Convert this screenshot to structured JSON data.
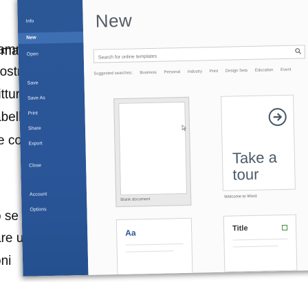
{
  "background_text": {
    "lines": [
      "ramma",
      "nostra",
      "rittura",
      "abelle,",
      "e  con",
      "o se",
      "are un",
      "oni"
    ]
  },
  "sidebar": {
    "items": [
      {
        "label": "Info",
        "active": false
      },
      {
        "label": "New",
        "active": true
      },
      {
        "label": "Open",
        "active": false
      },
      {
        "label": "Save",
        "active": false
      },
      {
        "label": "Save As",
        "active": false
      },
      {
        "label": "Print",
        "active": false
      },
      {
        "label": "Share",
        "active": false
      },
      {
        "label": "Export",
        "active": false
      },
      {
        "label": "Close",
        "active": false
      },
      {
        "label": "Account",
        "active": false
      },
      {
        "label": "Options",
        "active": false
      }
    ]
  },
  "main": {
    "title": "New",
    "search": {
      "placeholder": "Search for online templates"
    },
    "suggested": {
      "label": "Suggested searches:",
      "items": [
        "Business",
        "Personal",
        "Industry",
        "Print",
        "Design Sets",
        "Education",
        "Event"
      ]
    },
    "templates": {
      "blank": {
        "caption": "Blank document"
      },
      "tour": {
        "text_line1": "Take a",
        "text_line2": "tour",
        "caption": "Welcome to Word"
      },
      "aa": {
        "sample": "Aa"
      },
      "title": {
        "sample": "Title"
      }
    }
  },
  "colors": {
    "sidebar": "#2b5797",
    "sidebar_active": "#3f6fb3",
    "accent": "#2b5797"
  }
}
